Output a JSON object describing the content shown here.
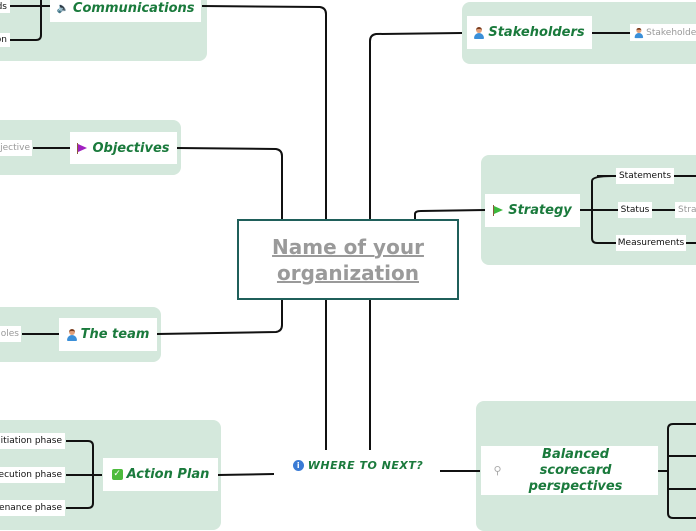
{
  "central": {
    "title": "Name of your organization"
  },
  "colors": {
    "topic_text": "#1a7a3c",
    "group_bg": "#d4e8dc",
    "central_border": "#1f5f5a",
    "central_text": "#9a9a9a",
    "objectives_flag": "#a020c0",
    "strategy_flag": "#3cb83c"
  },
  "topics": {
    "communications": {
      "label": "Communications",
      "icon": "speaker-icon",
      "children": [
        "ds",
        "on"
      ]
    },
    "stakeholders": {
      "label": "Stakeholders",
      "icon": "person-icon",
      "children": [
        "Stakeholder"
      ]
    },
    "objectives": {
      "label": "Objectives",
      "icon": "flag-icon",
      "children": [
        "jective"
      ]
    },
    "strategy": {
      "label": "Strategy",
      "icon": "flag-icon",
      "children": [
        "Statements",
        "Status",
        "Measurements"
      ],
      "status_child": "Stra"
    },
    "team": {
      "label": "The team",
      "icon": "person-icon",
      "children": [
        "oles"
      ]
    },
    "action_plan": {
      "label": "Action Plan",
      "icon": "check-icon",
      "children": [
        "Initiation phase",
        "xecution phase",
        "ntenance phase"
      ]
    },
    "where_next": {
      "label": "WHERE TO NEXT?",
      "icon": "info-icon"
    },
    "balanced": {
      "label": "Balanced scorecard perspectives",
      "icon": "magnifier-icon"
    }
  }
}
